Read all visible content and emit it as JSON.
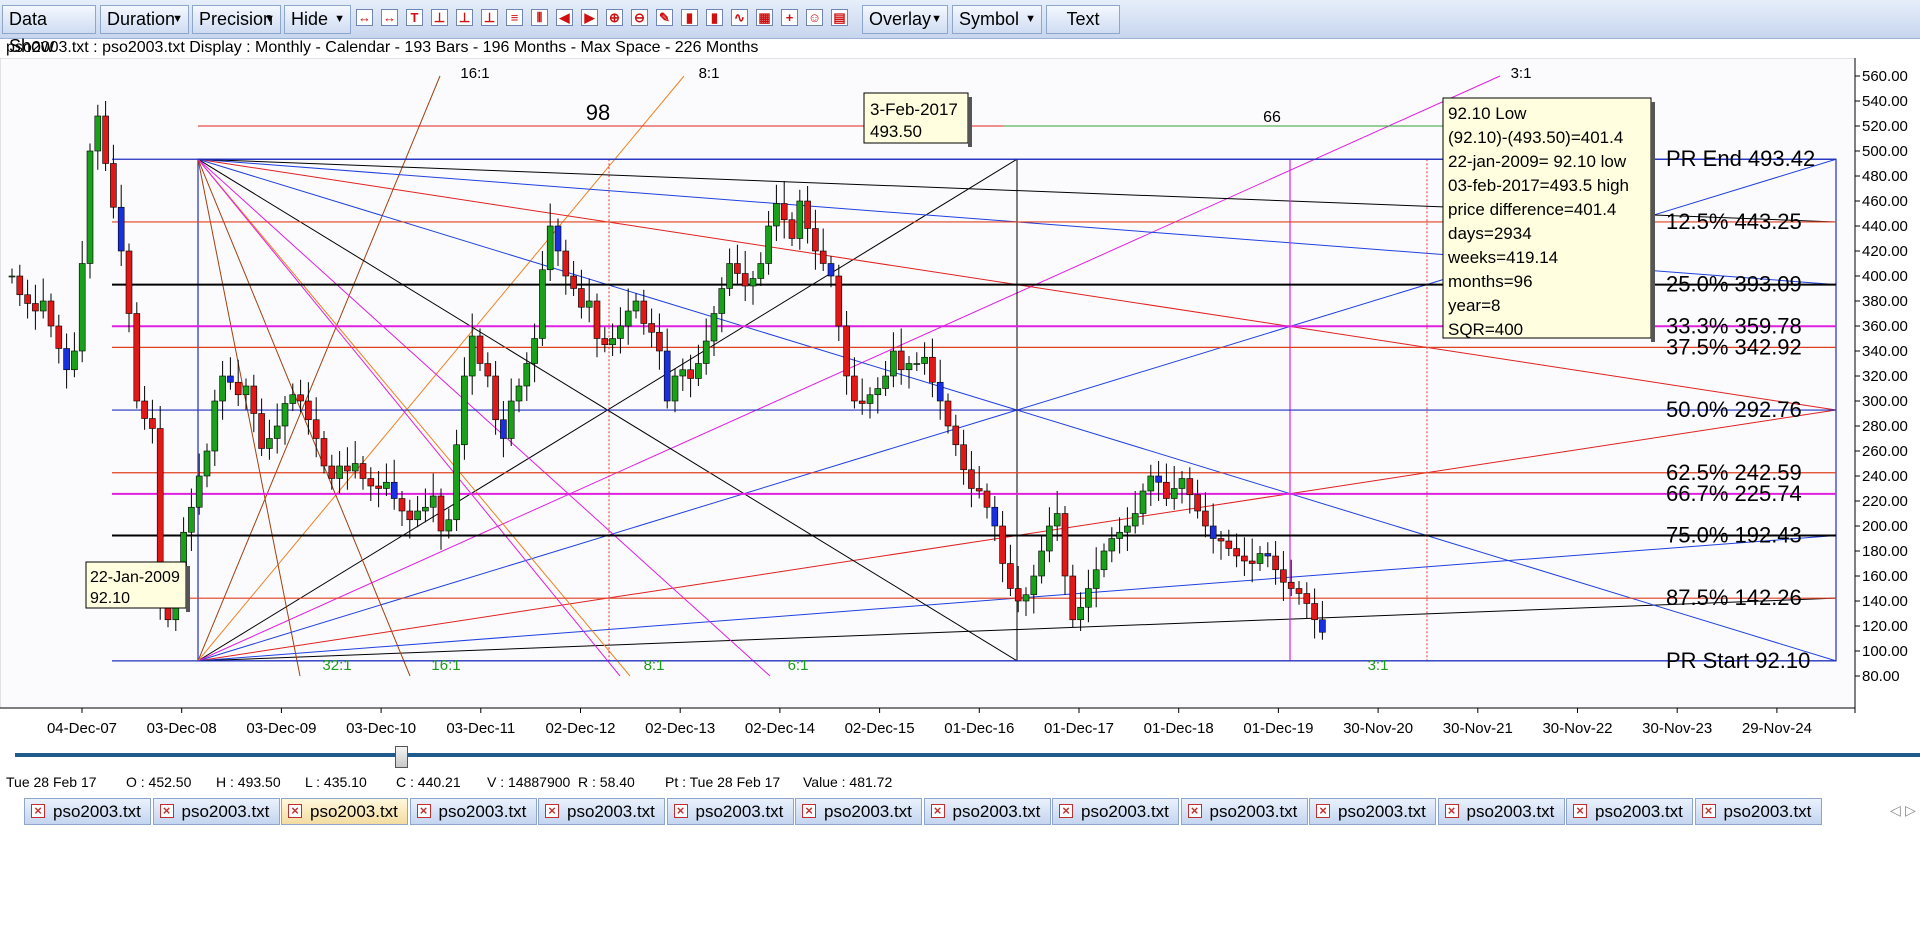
{
  "toolbar": {
    "data_show": "Data Show",
    "duration": "Duration",
    "precision": "Precision",
    "hide": "Hide",
    "overlay": "Overlay",
    "symbol": "Symbol",
    "text": "Text",
    "icons": [
      "arrows-in-icon",
      "arrows-out-icon",
      "line-tool-icon",
      "line-down-icon",
      "line-up-icon",
      "line-low-icon",
      "horizontal-lines-icon",
      "vertical-lines-icon",
      "prev-icon",
      "next-icon",
      "zoom-in-icon",
      "zoom-out-icon",
      "erase-icon",
      "bar-chart-icon",
      "bar-chart-2-icon",
      "line-chart-icon",
      "grid-icon",
      "plus-icon",
      "person-icon",
      "calculator-icon"
    ]
  },
  "info_line": "pso2003.txt : pso2003.txt Display :  Monthly  - Calendar - 193 Bars - 196 Months -  Max Space - 226 Months",
  "chart_data": {
    "type": "candlestick",
    "yaxis": {
      "min": 80,
      "max": 560,
      "ticks": [
        "560.00",
        "540.00",
        "520.00",
        "500.00",
        "480.00",
        "460.00",
        "440.00",
        "420.00",
        "400.00",
        "380.00",
        "360.00",
        "340.00",
        "320.00",
        "300.00",
        "280.00",
        "260.00",
        "240.00",
        "220.00",
        "200.00",
        "180.00",
        "160.00",
        "140.00",
        "120.00",
        "100.00",
        "80.00"
      ]
    },
    "xaxis": {
      "ticks": [
        "04-Dec-07",
        "03-Dec-08",
        "03-Dec-09",
        "03-Dec-10",
        "03-Dec-11",
        "02-Dec-12",
        "02-Dec-13",
        "02-Dec-14",
        "02-Dec-15",
        "01-Dec-16",
        "01-Dec-17",
        "01-Dec-18",
        "01-Dec-19",
        "30-Nov-20",
        "30-Nov-21",
        "30-Nov-22",
        "30-Nov-23",
        "29-Nov-24"
      ]
    },
    "retracements": [
      {
        "label": "PR End 493.42",
        "value": 493.42,
        "color": "#2030c0"
      },
      {
        "label": "12.5% 443.25",
        "value": 443.25,
        "color": "#e04020"
      },
      {
        "label": "25.0% 393.09",
        "value": 393.09,
        "color": "#000000"
      },
      {
        "label": "33.3% 359.78",
        "value": 359.78,
        "color": "#e020e0"
      },
      {
        "label": "37.5% 342.92",
        "value": 342.92,
        "color": "#e04020"
      },
      {
        "label": "50.0% 292.76",
        "value": 292.76,
        "color": "#2030c0"
      },
      {
        "label": "62.5% 242.59",
        "value": 242.59,
        "color": "#e04020"
      },
      {
        "label": "66.7% 225.74",
        "value": 225.74,
        "color": "#e020e0"
      },
      {
        "label": "75.0% 192.43",
        "value": 192.43,
        "color": "#000000"
      },
      {
        "label": "87.5% 142.26",
        "value": 142.26,
        "color": "#e04020"
      },
      {
        "label": "PR Start 92.10",
        "value": 92.1,
        "color": "#2030c0"
      }
    ],
    "angle_labels_top": [
      "16:1",
      "8:1",
      "3:1"
    ],
    "angle_labels_bottom": [
      "32:1",
      "16:1",
      "8:1",
      "6:1",
      "3:1"
    ],
    "range_labels": {
      "left": "98",
      "right": "66"
    },
    "high_box": {
      "date": "3-Feb-2017",
      "price": "493.50"
    },
    "low_box": {
      "date": "22-Jan-2009",
      "price": "92.10"
    },
    "info_box": [
      "92.10 Low",
      "(92.10)-(493.50)=401.4",
      "22-jan-2009= 92.10 low",
      "03-feb-2017=493.5 high",
      "price difference=401.4",
      "days=2934",
      "weeks=419.14",
      "months=96",
      "year=8",
      "SQR=400"
    ],
    "closes": [
      400,
      385,
      378,
      372,
      380,
      360,
      342,
      325,
      340,
      410,
      500,
      528,
      490,
      455,
      420,
      370,
      300,
      286,
      278,
      140,
      125,
      160,
      195,
      215,
      240,
      260,
      300,
      320,
      315,
      305,
      312,
      290,
      262,
      270,
      280,
      298,
      305,
      300,
      285,
      270,
      248,
      238,
      248,
      244,
      250,
      238,
      232,
      230,
      235,
      222,
      212,
      205,
      212,
      215,
      224,
      196,
      205,
      265,
      320,
      352,
      330,
      320,
      285,
      270,
      300,
      312,
      330,
      350,
      405,
      440,
      420,
      400,
      390,
      375,
      380,
      350,
      345,
      350,
      360,
      372,
      380,
      362,
      355,
      340,
      300,
      320,
      325,
      318,
      330,
      348,
      370,
      390,
      410,
      402,
      392,
      398,
      410,
      440,
      458,
      445,
      430,
      460,
      438,
      420,
      410,
      400,
      360,
      320,
      300,
      298,
      305,
      310,
      320,
      340,
      325,
      330,
      330,
      335,
      315,
      300,
      280,
      265,
      245,
      230,
      228,
      215,
      200,
      170,
      150,
      140,
      145,
      160,
      180,
      200,
      210,
      160,
      125,
      135,
      150,
      165,
      180,
      190,
      195,
      200,
      210,
      228,
      240,
      235,
      222,
      230,
      238,
      225,
      212,
      200,
      190,
      188,
      182,
      176,
      172,
      170,
      178,
      176,
      165,
      155,
      150,
      146,
      138,
      125,
      115
    ]
  },
  "status_bar": {
    "date": "Tue 28 Feb 17",
    "open": "O : 452.50",
    "high": "H : 493.50",
    "low": "L : 435.10",
    "close": "C : 440.21",
    "volume": "V : 14887900",
    "range": "R : 58.40",
    "pt": "Pt : Tue 28 Feb 17",
    "value": "Value : 481.72"
  },
  "tabs": [
    "pso2003.txt",
    "pso2003.txt",
    "pso2003.txt",
    "pso2003.txt",
    "pso2003.txt",
    "pso2003.txt",
    "pso2003.txt",
    "pso2003.txt",
    "pso2003.txt",
    "pso2003.txt",
    "pso2003.txt",
    "pso2003.txt",
    "pso2003.txt",
    "pso2003.txt"
  ],
  "active_tab": 2
}
